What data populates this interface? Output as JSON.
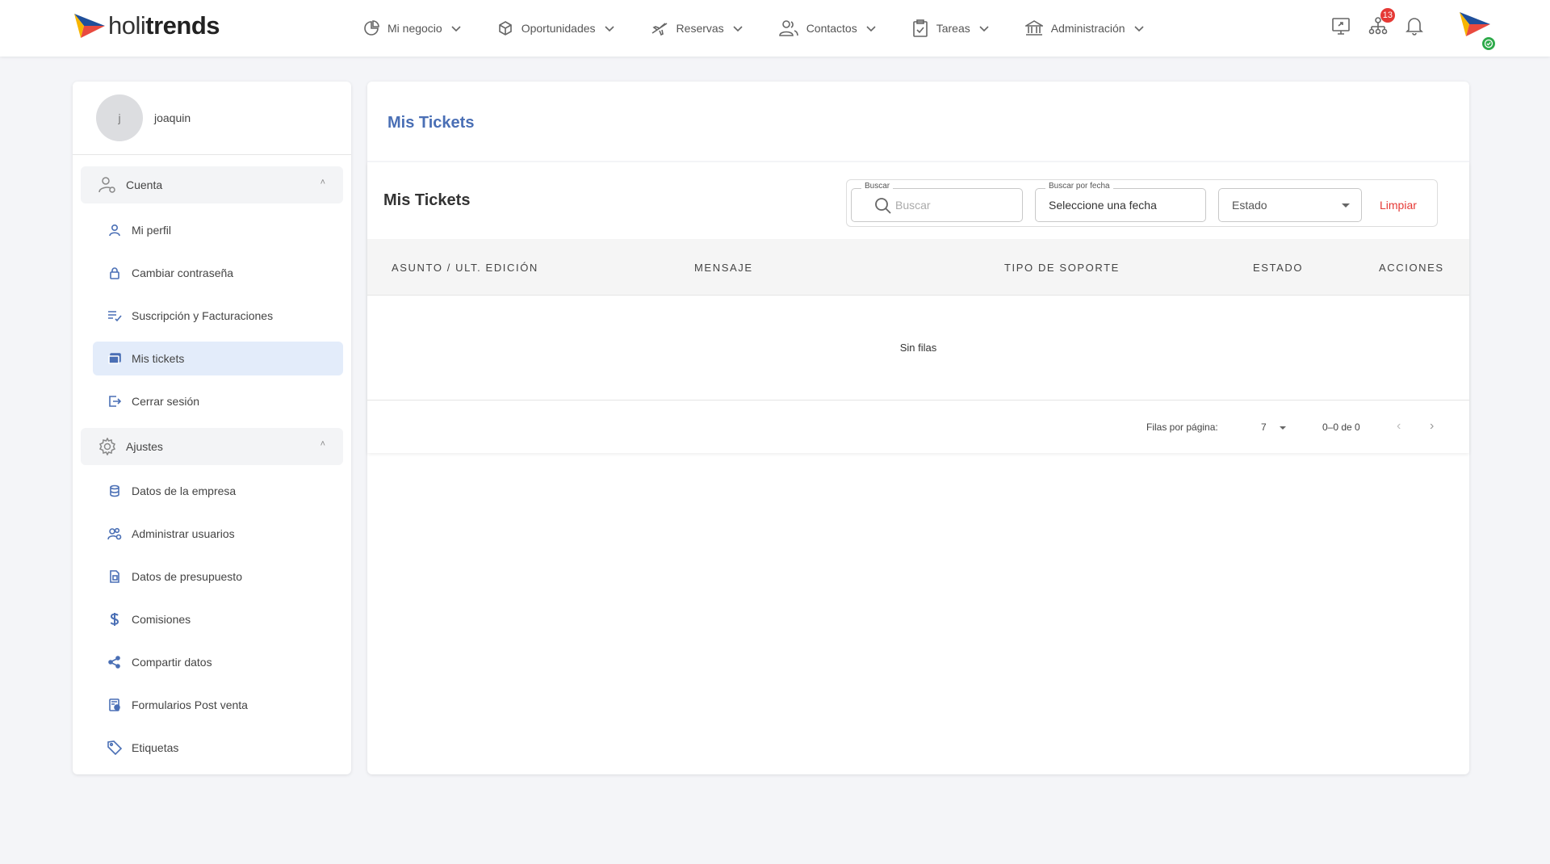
{
  "brand": {
    "name_light": "holi",
    "name_bold": "trends"
  },
  "nav": {
    "items": [
      {
        "label": "Mi negocio",
        "icon": "chart-pie-icon"
      },
      {
        "label": "Oportunidades",
        "icon": "cube-icon"
      },
      {
        "label": "Reservas",
        "icon": "plane-icon"
      },
      {
        "label": "Contactos",
        "icon": "users-icon"
      },
      {
        "label": "Tareas",
        "icon": "clipboard-icon"
      },
      {
        "label": "Administración",
        "icon": "bank-icon"
      }
    ]
  },
  "topbar": {
    "notifications_badge": "13",
    "status_color": "#2eaa4a"
  },
  "sidebar": {
    "user": {
      "initial": "j",
      "name": "joaquin"
    },
    "sections": [
      {
        "title": "Cuenta",
        "items": [
          {
            "label": "Mi perfil",
            "icon": "user-icon"
          },
          {
            "label": "Cambiar contraseña",
            "icon": "lock-icon"
          },
          {
            "label": "Suscripción y Facturaciones",
            "icon": "list-check-icon"
          },
          {
            "label": "Mis tickets",
            "icon": "tickets-icon",
            "active": true
          },
          {
            "label": "Cerrar sesión",
            "icon": "logout-icon"
          }
        ]
      },
      {
        "title": "Ajustes",
        "items": [
          {
            "label": "Datos de la empresa",
            "icon": "database-icon"
          },
          {
            "label": "Administrar usuarios",
            "icon": "users-settings-icon"
          },
          {
            "label": "Datos de presupuesto",
            "icon": "document-icon"
          },
          {
            "label": "Comisiones",
            "icon": "dollar-icon"
          },
          {
            "label": "Compartir datos",
            "icon": "share-icon"
          },
          {
            "label": "Formularios Post venta",
            "icon": "form-icon"
          },
          {
            "label": "Etiquetas",
            "icon": "tag-icon"
          }
        ]
      }
    ]
  },
  "main": {
    "title": "Mis Tickets",
    "panel_title": "Mis Tickets",
    "filters": {
      "search_label": "Buscar",
      "search_placeholder": "Buscar",
      "date_label": "Buscar por fecha",
      "date_value": "Seleccione una fecha",
      "estado_label": "Estado",
      "clear_label": "Limpiar"
    },
    "columns": [
      "Asunto / Ult. Edición",
      "Mensaje",
      "Tipo de soporte",
      "Estado",
      "Acciones"
    ],
    "empty_text": "Sin filas",
    "pagination": {
      "rows_per_page_label": "Filas por página:",
      "rows_per_page": "7",
      "range": "0–0 de 0"
    }
  },
  "colors": {
    "accent": "#4a6fb5",
    "danger": "#e53935",
    "active_bg": "#e3ecfa"
  }
}
